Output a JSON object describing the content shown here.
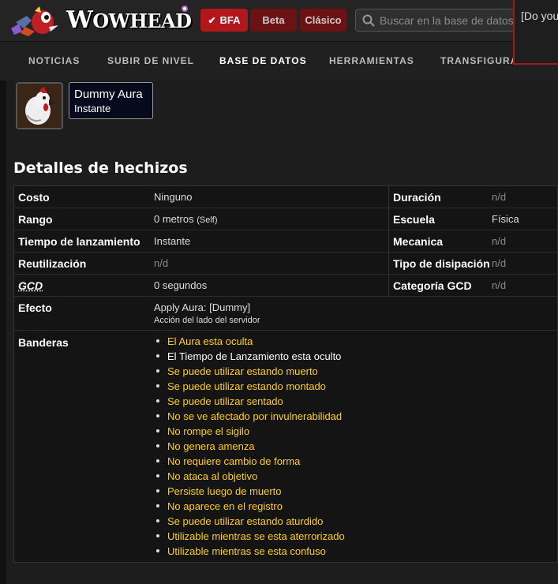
{
  "header": {
    "logo_text_big": "W",
    "logo_text_rest": "OWHEAD",
    "versions": [
      {
        "label": "BFA",
        "active": true
      },
      {
        "label": "Beta",
        "active": false
      },
      {
        "label": "Clásico",
        "active": false
      }
    ],
    "search": {
      "placeholder": "Buscar en la base de datos",
      "value": ""
    },
    "popup_text": "[Do you"
  },
  "nav": {
    "items": [
      "NOTICIAS",
      "SUBIR DE NIVEL",
      "BASE DE DATOS",
      "HERRAMIENTAS",
      "TRANSFIGURA"
    ],
    "active": "BASE DE DATOS"
  },
  "spell": {
    "name": "Dummy Aura",
    "cast": "Instante"
  },
  "details": {
    "title": "Detalles de hechizos",
    "left_rows": [
      {
        "label": "Costo",
        "value": "Ninguno"
      },
      {
        "label": "Rango",
        "value": "0 metros",
        "extra": "(Self)"
      },
      {
        "label": "Tiempo de lanzamiento",
        "value": "Instante"
      },
      {
        "label": "Reutilización",
        "value": "n/d"
      },
      {
        "label": "GCD",
        "value": "0 segundos"
      }
    ],
    "right_rows": [
      {
        "label": "Duración",
        "value": "n/d"
      },
      {
        "label": "Escuela",
        "value": "Física"
      },
      {
        "label": "Mecanica",
        "value": "n/d"
      },
      {
        "label": "Tipo de disipación",
        "value": "n/d"
      },
      {
        "label": "Categoría GCD",
        "value": "n/d"
      }
    ],
    "effect": {
      "label": "Efecto",
      "value": "Apply Aura: [Dummy]",
      "note": "Acción del lado del servidor"
    },
    "flags_label": "Banderas",
    "flags": [
      "El Aura esta oculta",
      "El Tiempo de Lanzamiento esta oculto",
      "Se puede utilizar estando muerto",
      "Se puede utilizar estando montado",
      "Se puede utilizar sentado",
      "No se ve afectado por invulnerabilidad",
      "No rompe el sigilo",
      "No genera amenza",
      "No requiere cambio de forma",
      "No ataca al objetivo",
      "Persiste luego de muerto",
      "No aparece en el registro",
      "Se puede utilizar estando aturdido",
      "Utilizable mientras se esta aterrorizado",
      "Utilizable mientras se esta confuso"
    ]
  },
  "colors": {
    "accent_red": "#b3171c",
    "flag_yellow": "#ffd100",
    "background": "#181818"
  }
}
